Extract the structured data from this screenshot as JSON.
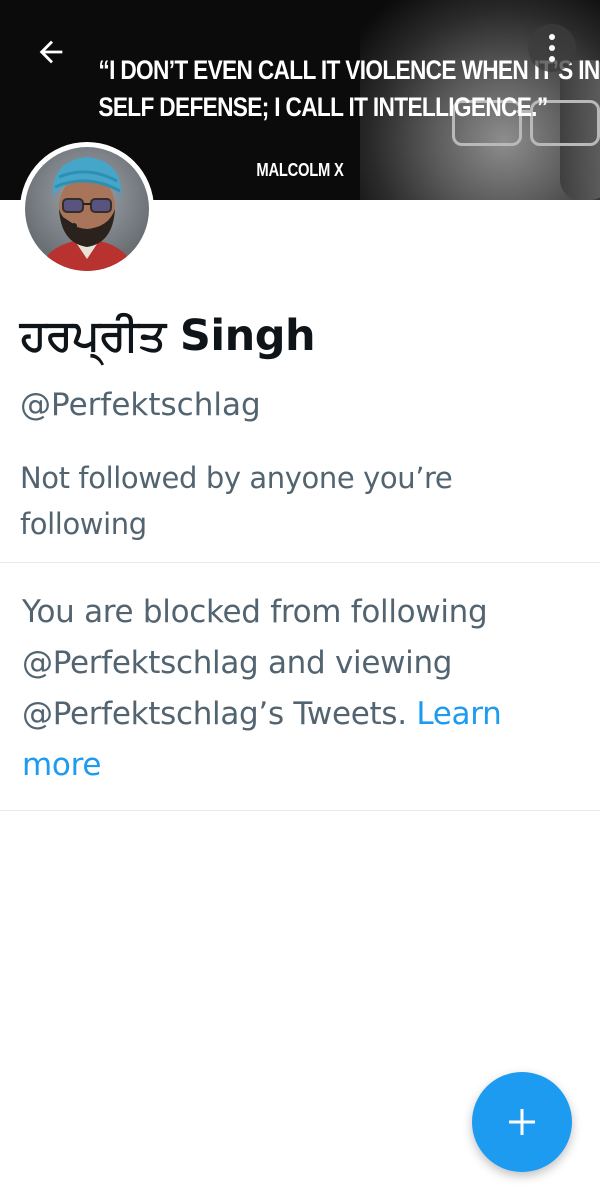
{
  "banner": {
    "quote_line1": "“I DON’T EVEN CALL IT VIOLENCE WHEN IT’S IN",
    "quote_line2": "SELF DEFENSE; I CALL IT INTELLIGENCE.”",
    "quote_author": "MALCOLM X"
  },
  "icons": {
    "back": "back-arrow-icon",
    "more": "more-vertical-icon",
    "compose": "plus-icon"
  },
  "profile": {
    "display_name": "ਹਰਪ੍ਰੀਤ Singh",
    "handle": "@Perfektschlag",
    "followed_by_text": "Not followed by anyone you’re following"
  },
  "blocked": {
    "message": "You are blocked from following @Perfektschlag and viewing @Perfektschlag’s Tweets.",
    "learn_more": "Learn more"
  },
  "colors": {
    "accent": "#1d9bf0",
    "secondary_text": "#536471",
    "primary_text": "#0f1419",
    "divider": "#e7e9ea"
  }
}
